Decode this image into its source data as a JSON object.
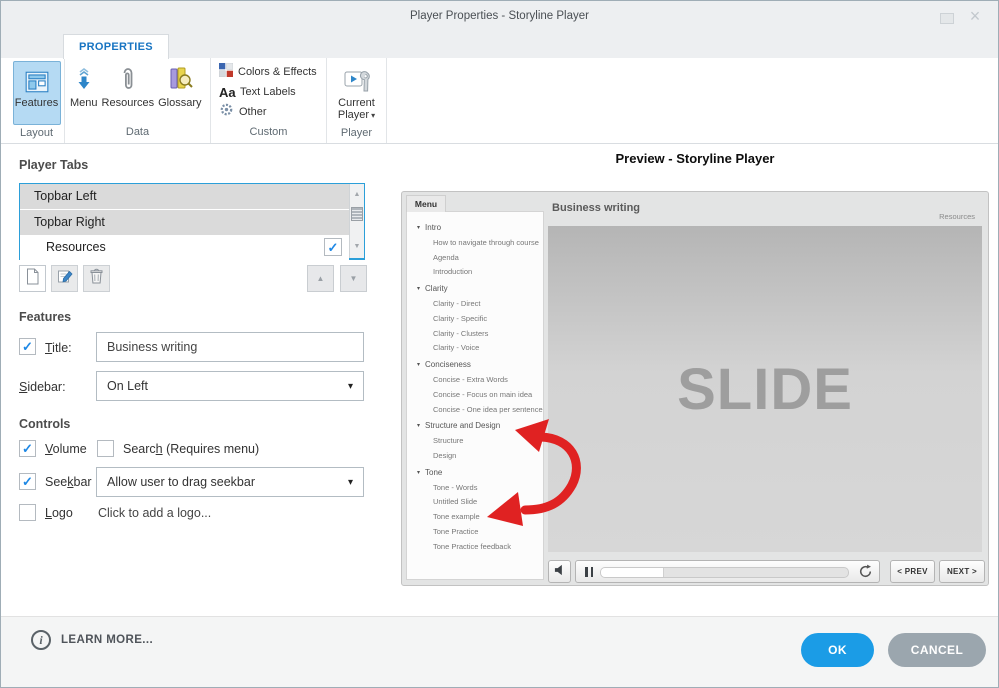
{
  "window": {
    "title": "Player Properties - Storyline Player",
    "close_glyph": "×"
  },
  "ribbon": {
    "tab": "PROPERTIES",
    "groups": {
      "layout": "Layout",
      "data": "Data",
      "custom": "Custom",
      "player": "Player"
    },
    "buttons": {
      "features": "Features",
      "menu": "Menu",
      "resources": "Resources",
      "glossary": "Glossary",
      "colors_effects": "Colors & Effects",
      "aa_glyph": "Aa",
      "text_labels": "Text Labels",
      "other": "Other",
      "current_player_line1": "Current",
      "current_player_line2": "Player"
    }
  },
  "player_tabs": {
    "heading": "Player Tabs",
    "rows": [
      {
        "label": "Topbar Left",
        "checked": false
      },
      {
        "label": "Topbar Right",
        "checked": false
      },
      {
        "label": "Resources",
        "checked": true
      }
    ]
  },
  "features_section": {
    "heading": "Features",
    "title_label": {
      "pre": "",
      "accel": "T",
      "post": "itle:"
    },
    "title_checked": true,
    "title_value": "Business writing",
    "sidebar_label": {
      "pre": "",
      "accel": "S",
      "post": "idebar:"
    },
    "sidebar_value": "On Left"
  },
  "controls_section": {
    "heading": "Controls",
    "volume": {
      "pre": "",
      "accel": "V",
      "post": "olume"
    },
    "volume_checked": true,
    "search": {
      "pre": "Searc",
      "accel": "h",
      "post": " (Requires menu)"
    },
    "search_checked": false,
    "seekbar": {
      "pre": "See",
      "accel": "k",
      "post": "bar"
    },
    "seekbar_checked": true,
    "seekbar_value": "Allow user to drag seekbar",
    "logo": {
      "pre": "",
      "accel": "L",
      "post": "ogo"
    },
    "logo_checked": false,
    "logo_hint": "Click to add a logo..."
  },
  "preview": {
    "heading": "Preview - Storyline Player",
    "menu_tab": "Menu",
    "course_title": "Business writing",
    "resources_tab": "Resources",
    "slide_placeholder": "SLIDE",
    "menu_items": [
      {
        "type": "header",
        "label": "Intro"
      },
      {
        "type": "item",
        "label": "How to navigate through course"
      },
      {
        "type": "item",
        "label": "Agenda"
      },
      {
        "type": "item",
        "label": "Introduction"
      },
      {
        "type": "header",
        "label": "Clarity"
      },
      {
        "type": "item",
        "label": "Clarity - Direct"
      },
      {
        "type": "item",
        "label": "Clarity - Specific"
      },
      {
        "type": "item",
        "label": "Clarity - Clusters"
      },
      {
        "type": "item",
        "label": "Clarity - Voice"
      },
      {
        "type": "header",
        "label": "Conciseness"
      },
      {
        "type": "item",
        "label": "Concise - Extra Words"
      },
      {
        "type": "item",
        "label": "Concise - Focus on main idea"
      },
      {
        "type": "item",
        "label": "Concise - One idea per sentence"
      },
      {
        "type": "header",
        "label": "Structure and Design"
      },
      {
        "type": "item",
        "label": "Structure"
      },
      {
        "type": "item",
        "label": "Design"
      },
      {
        "type": "header",
        "label": "Tone"
      },
      {
        "type": "item",
        "label": "Tone - Words"
      },
      {
        "type": "item",
        "label": "Untitled Slide"
      },
      {
        "type": "item",
        "label": "Tone example"
      },
      {
        "type": "item",
        "label": "Tone Practice"
      },
      {
        "type": "item",
        "label": "Tone Practice feedback"
      }
    ],
    "player_bar": {
      "prev_chevron": "<",
      "prev": "PREV",
      "next": "NEXT",
      "next_chevron": ">",
      "progress_pct": 25
    }
  },
  "footer": {
    "info_glyph": "i",
    "learn_more": "LEARN MORE...",
    "ok": "OK",
    "cancel": "CANCEL"
  },
  "glyphs": {
    "check": "✓",
    "caret_down": "▾",
    "triangle_up": "▲",
    "triangle_down": "▼"
  },
  "colors": {
    "accent_blue": "#1b9ce6",
    "cancel_gray": "#9ba6ae",
    "annotation_red": "#e02222",
    "features_highlight": "#b5daf3",
    "tab_text_blue": "#1774c2",
    "list_border_blue": "#2b9fd9"
  }
}
